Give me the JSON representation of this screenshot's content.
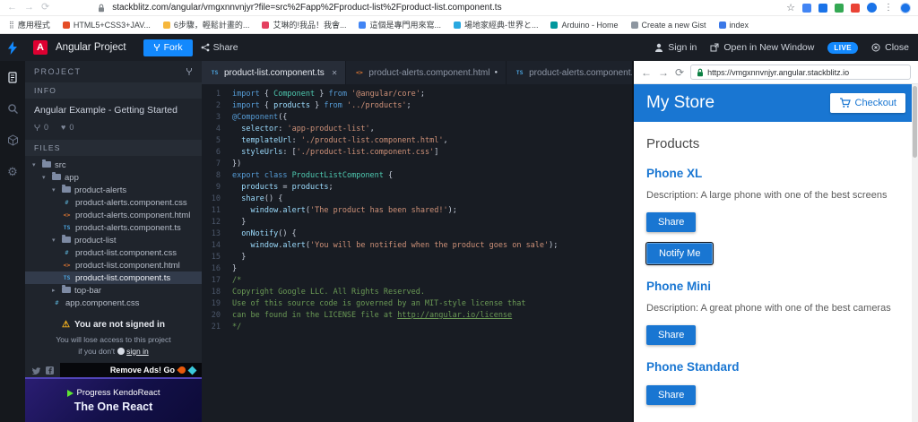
{
  "browser": {
    "url": "stackblitz.com/angular/vmgxnnvnjyr?file=src%2Fapp%2Fproduct-list%2Fproduct-list.component.ts",
    "toolbar_icons": [
      "back-icon",
      "forward-icon",
      "refresh-icon",
      "lock-icon",
      "bookmark-star-icon",
      "cast-icon",
      "translate-icon",
      "extension-icon",
      "avatar",
      "browser-menu-icon",
      "profile-icon"
    ],
    "bookmarks": [
      {
        "label": "應用程式",
        "color": "#5f6368",
        "icon": "apps"
      },
      {
        "label": "HTML5+CSS3+JAV...",
        "color": "#e44d26"
      },
      {
        "label": "6步驟，輕鬆計畫的...",
        "color": "#f6b73c"
      },
      {
        "label": "艾琳的!我品！我會...",
        "color": "#e4405f"
      },
      {
        "label": "這個是專門用來寫...",
        "color": "#4285f4"
      },
      {
        "label": "場地家經典-世界と...",
        "color": "#29a8e0"
      },
      {
        "label": "Arduino - Home",
        "color": "#00979d"
      },
      {
        "label": "Create a new Gist",
        "color": "#8d96a0"
      },
      {
        "label": "index",
        "color": "#3b78e7"
      }
    ]
  },
  "header": {
    "project_name": "Angular Project",
    "fork_label": "Fork",
    "share_label": "Share",
    "sign_in_label": "Sign in",
    "open_window_label": "Open in New Window",
    "live_badge": "LIVE",
    "close_label": "Close",
    "accent_color": "#1389fd"
  },
  "activity_bar": {
    "icons": [
      "project-files-icon",
      "search-icon",
      "deploy-icon",
      "settings-icon"
    ]
  },
  "sidebar": {
    "project_label": "PROJECT",
    "info_label": "INFO",
    "project_title": "Angular Example - Getting Started",
    "forks_count": "0",
    "likes_count": "0",
    "files_label": "FILES",
    "files": [
      {
        "name": "src",
        "type": "folder",
        "level": 0,
        "expanded": true
      },
      {
        "name": "app",
        "type": "folder",
        "level": 1,
        "expanded": true
      },
      {
        "name": "product-alerts",
        "type": "folder",
        "level": 2,
        "expanded": true
      },
      {
        "name": "product-alerts.component.css",
        "type": "css",
        "level": 3
      },
      {
        "name": "product-alerts.component.html",
        "type": "html",
        "level": 3
      },
      {
        "name": "product-alerts.component.ts",
        "type": "ts",
        "level": 3
      },
      {
        "name": "product-list",
        "type": "folder",
        "level": 2,
        "expanded": true
      },
      {
        "name": "product-list.component.css",
        "type": "css",
        "level": 3
      },
      {
        "name": "product-list.component.html",
        "type": "html",
        "level": 3
      },
      {
        "name": "product-list.component.ts",
        "type": "ts",
        "level": 3,
        "selected": true
      },
      {
        "name": "top-bar",
        "type": "folder",
        "level": 2,
        "expanded": false
      },
      {
        "name": "app.component.css",
        "type": "css",
        "level": 2
      }
    ],
    "warning_title": "You are not signed in",
    "warning_line1": "You will lose access to this project",
    "warning_line2": "if you don't",
    "sign_in_link": "sign in",
    "remove_ads_label": "Remove Ads! Go",
    "ad": {
      "brand": "Progress KendoReact",
      "tagline": "The One React"
    }
  },
  "editor": {
    "tabs": [
      {
        "label": "product-list.component.ts",
        "icon": "ts",
        "active": true,
        "modified": false
      },
      {
        "label": "product-alerts.component.html",
        "icon": "html",
        "active": false,
        "modified": true
      },
      {
        "label": "product-alerts.component.ts",
        "icon": "ts",
        "active": false,
        "modified": true
      }
    ],
    "code_lines": [
      "import { Component } from '@angular/core';",
      "import { products } from '../products';",
      "@Component({",
      "  selector: 'app-product-list',",
      "  templateUrl: './product-list.component.html',",
      "  styleUrls: ['./product-list.component.css']",
      "})",
      "export class ProductListComponent {",
      "  products = products;",
      "  share() {",
      "    window.alert('The product has been shared!');",
      "  }",
      "  onNotify() {",
      "    window.alert('You will be notified when the product goes on sale');",
      "  }",
      "}",
      "/*",
      "Copyright Google LLC. All Rights Reserved.",
      "Use of this source code is governed by an MIT-style license that",
      "can be found in the LICENSE file at http://angular.io/license",
      "*/"
    ]
  },
  "preview": {
    "url": "https://vmgxnnvnjyr.angular.stackblitz.io",
    "store_title": "My Store",
    "checkout_label": "Checkout",
    "products_heading": "Products",
    "header_color": "#1976d2",
    "products": [
      {
        "name": "Phone XL",
        "description": "Description: A large phone with one of the best screens",
        "share_label": "Share",
        "notify_label": "Notify Me"
      },
      {
        "name": "Phone Mini",
        "description": "Description: A great phone with one of the best cameras",
        "share_label": "Share"
      },
      {
        "name": "Phone Standard",
        "share_label": "Share"
      }
    ]
  }
}
